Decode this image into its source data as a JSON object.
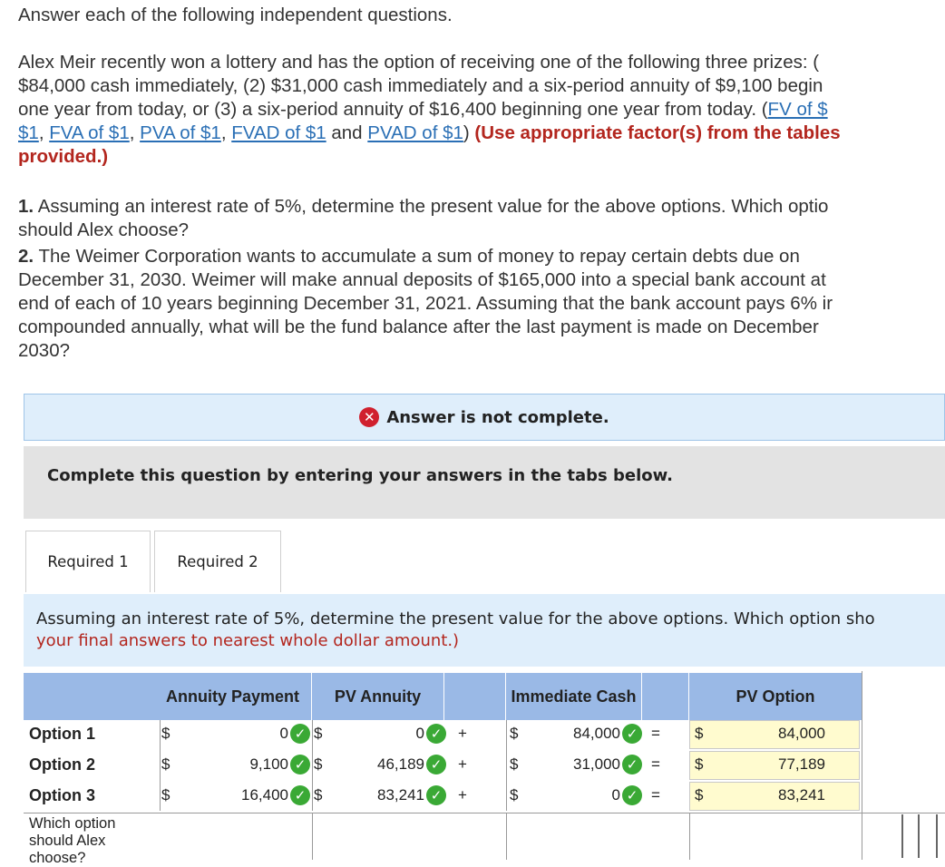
{
  "intro": "Answer each of the following independent questions.",
  "problem": {
    "line1": "Alex Meir recently won a lottery and has the option of receiving one of the following three prizes: (",
    "line2": "$84,000 cash immediately, (2) $31,000 cash immediately and a six-period annuity of $9,100 begin",
    "line3": "one year from today, or (3) a six-period annuity of $16,400 beginning one year from today. (",
    "link_fv": "FV of $",
    "link_fv_cont": "$1",
    "link_fva": "FVA of $1",
    "link_pva": "PVA of $1",
    "link_fvad": "FVAD of $1",
    "link_pvad": "PVAD of $1",
    "and_text": "and",
    "comma": ",",
    "close_paren": ")",
    "note_line1": "(Use appropriate factor(s) from the tables",
    "note_line2": "provided.)"
  },
  "questions": {
    "q1_num": "1.",
    "q1_line1": "Assuming an interest rate of 5%, determine the present value for the above options. Which optio",
    "q1_line2": "should Alex choose?",
    "q2_num": "2.",
    "q2_line1": "The Weimer Corporation wants to accumulate a sum of money to repay certain debts due on",
    "q2_line2": "December 31, 2030. Weimer will make annual deposits of $165,000 into a special bank account at",
    "q2_line3": "end of each of 10 years beginning December 31, 2021. Assuming that the bank account pays 6% ir",
    "q2_line4": "compounded annually, what will be the fund balance after the last payment is made on December",
    "q2_line5": "2030?"
  },
  "banner": {
    "icon": "x-circle-icon",
    "text": "Answer is not complete."
  },
  "complete_prompt": "Complete this question by entering your answers in the tabs below.",
  "tabs": [
    {
      "label": "Required 1"
    },
    {
      "label": "Required 2"
    }
  ],
  "instruction": {
    "line1": "Assuming an interest rate of 5%, determine the present value for the above options. Which option sho",
    "line2": "your final answers to nearest whole dollar amount.)"
  },
  "table": {
    "headers": {
      "annuity_payment": "Annuity Payment",
      "pv_annuity": "PV Annuity",
      "immediate_cash": "Immediate Cash",
      "pv_option": "PV Option"
    },
    "dollar": "$",
    "plus": "+",
    "equals": "=",
    "rows": [
      {
        "label": "Option 1",
        "annuity_payment": "0",
        "pv_annuity": "0",
        "immediate_cash": "84,000",
        "pv_option": "84,000"
      },
      {
        "label": "Option 2",
        "annuity_payment": "9,100",
        "pv_annuity": "46,189",
        "immediate_cash": "31,000",
        "pv_option": "77,189"
      },
      {
        "label": "Option 3",
        "annuity_payment": "16,400",
        "pv_annuity": "83,241",
        "immediate_cash": "0",
        "pv_option": "83,241"
      }
    ],
    "choose_label": "Which option should Alex choose?",
    "choose_value": ""
  },
  "colors": {
    "accent": "#9ab9e6",
    "banner_bg": "#dfeefb",
    "pv_option_bg": "#fffbcf",
    "check": "#3aa935",
    "error": "#d0202e"
  }
}
